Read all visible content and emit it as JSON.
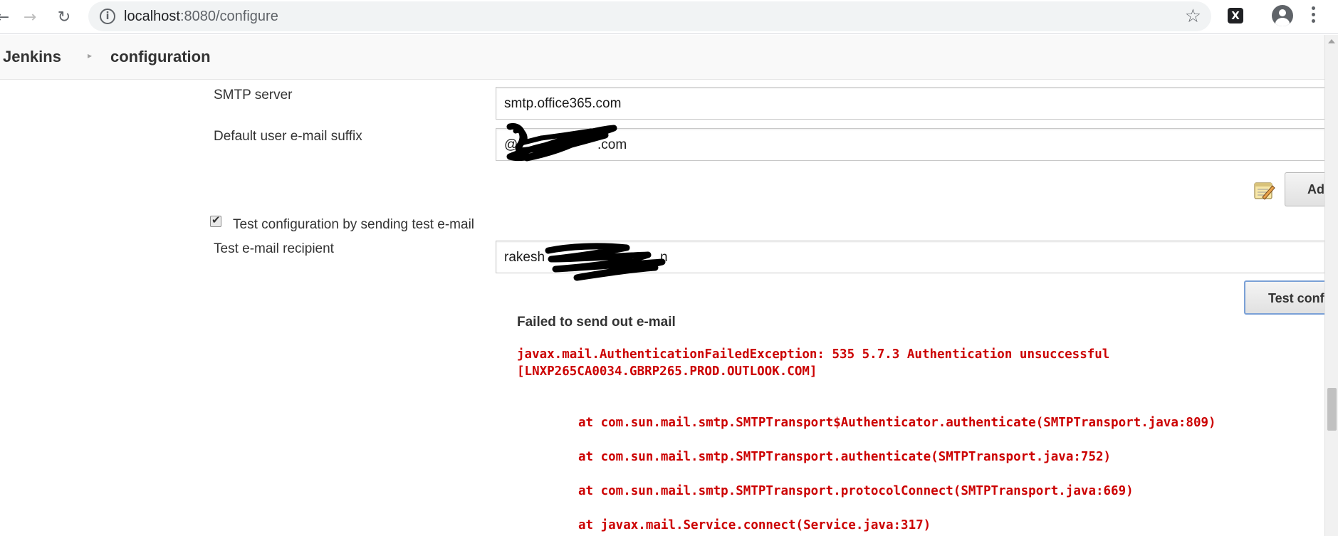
{
  "browser": {
    "url_host": "localhost",
    "url_path": ":8080/configure",
    "back_glyph": "←",
    "forward_glyph": "→",
    "reload_glyph": "↻",
    "star_glyph": "☆",
    "info_glyph": "i",
    "extension_glyph": "X"
  },
  "breadcrumb": {
    "home": "Jenkins",
    "separator": "▸",
    "current": "configuration"
  },
  "form": {
    "smtp_server_label": "SMTP server",
    "smtp_server_value": "smtp.office365.com",
    "email_suffix_label": "Default user e-mail suffix",
    "email_suffix_value_start": "@",
    "email_suffix_value_end": ".com",
    "advanced_button": "Ad",
    "test_checkbox_label": "Test configuration by sending test e-mail",
    "test_checkbox_checked": true,
    "recipient_label": "Test e-mail recipient",
    "recipient_value_start": "rakesh",
    "recipient_value_end": "n",
    "test_button": "Test conf"
  },
  "result": {
    "title": "Failed to send out e-mail",
    "error_line1": "javax.mail.AuthenticationFailedException: 535 5.7.3 Authentication unsuccessful",
    "error_line2": "[LNXP265CA0034.GBRP265.PROD.OUTLOOK.COM]",
    "stack": [
      "at com.sun.mail.smtp.SMTPTransport$Authenticator.authenticate(SMTPTransport.java:809)",
      "at com.sun.mail.smtp.SMTPTransport.authenticate(SMTPTransport.java:752)",
      "at com.sun.mail.smtp.SMTPTransport.protocolConnect(SMTPTransport.java:669)",
      "at javax.mail.Service.connect(Service.java:317)"
    ]
  },
  "colors": {
    "error_text": "#cc0000",
    "focus_border": "#7aa0d6"
  }
}
